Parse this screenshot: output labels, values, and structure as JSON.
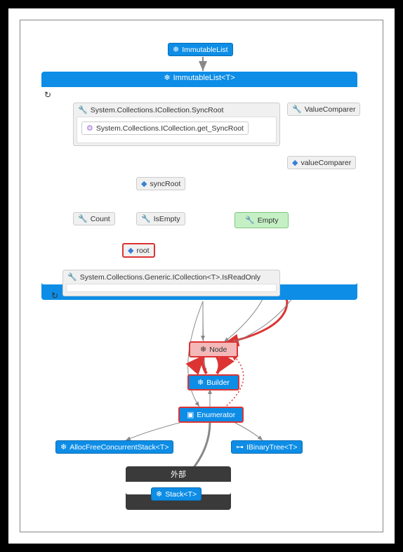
{
  "title_top": "ImmutableList",
  "container_main": "ImmutableList<T>",
  "syncroot_group": "System.Collections.ICollection.SyncRoot",
  "syncroot_method": "System.Collections.ICollection.get_SyncRoot",
  "syncroot_field": "syncRoot",
  "valuecomparer_prop": "ValueComparer",
  "valuecomparer_field": "valueComparer",
  "count": "Count",
  "isempty": "IsEmpty",
  "empty": "Empty",
  "root": "root",
  "readonly_group": "System.Collections.Generic.ICollection<T>.IsReadOnly",
  "node": "Node",
  "builder": "Builder",
  "enumerator": "Enumerator",
  "allocfree": "AllocFreeConcurrentStack<T>",
  "ibinarytree": "IBinaryTree<T>",
  "external_label": "外部",
  "stack": "Stack<T>",
  "icons": {
    "class": "❄",
    "wrench": "🔧",
    "field": "◆",
    "method": "⚙",
    "struct": "▣",
    "interface": "⊶",
    "cycle": "↻"
  },
  "chart_data": {
    "type": "diagram",
    "description": "Code map / dependency diagram for ImmutableList<T>",
    "nodes": [
      {
        "id": "ImmutableList",
        "kind": "class",
        "color": "blue"
      },
      {
        "id": "ImmutableList<T>",
        "kind": "class-container",
        "color": "blue",
        "children": [
          {
            "id": "System.Collections.ICollection.SyncRoot",
            "kind": "property-group",
            "children": [
              {
                "id": "System.Collections.ICollection.get_SyncRoot",
                "kind": "method"
              }
            ]
          },
          {
            "id": "syncRoot",
            "kind": "field"
          },
          {
            "id": "ValueComparer",
            "kind": "property"
          },
          {
            "id": "valueComparer",
            "kind": "field"
          },
          {
            "id": "Count",
            "kind": "property"
          },
          {
            "id": "IsEmpty",
            "kind": "property"
          },
          {
            "id": "Empty",
            "kind": "property",
            "highlight": "green"
          },
          {
            "id": "root",
            "kind": "field",
            "highlight": "red-border"
          },
          {
            "id": "System.Collections.Generic.ICollection<T>.IsReadOnly",
            "kind": "property-group"
          }
        ]
      },
      {
        "id": "Node",
        "kind": "class",
        "highlight": "pink"
      },
      {
        "id": "Builder",
        "kind": "class",
        "highlight": "red-border",
        "color": "blue"
      },
      {
        "id": "Enumerator",
        "kind": "struct",
        "highlight": "red-border",
        "color": "blue"
      },
      {
        "id": "AllocFreeConcurrentStack<T>",
        "kind": "class",
        "color": "blue"
      },
      {
        "id": "IBinaryTree<T>",
        "kind": "interface",
        "color": "blue"
      },
      {
        "id": "外部",
        "kind": "external-group",
        "children": [
          {
            "id": "Stack<T>",
            "kind": "class",
            "color": "blue"
          }
        ]
      }
    ],
    "edges": [
      {
        "from": "ImmutableList",
        "to": "ImmutableList<T>",
        "style": "solid"
      },
      {
        "from": "System.Collections.ICollection.get_SyncRoot",
        "to": "syncRoot",
        "style": "dashed"
      },
      {
        "from": "ValueComparer",
        "to": "valueComparer",
        "style": "dashed"
      },
      {
        "from": "ImmutableList<T>",
        "to": "Empty",
        "style": "solid-thick"
      },
      {
        "from": "Count",
        "to": "root",
        "style": "solid"
      },
      {
        "from": "IsEmpty",
        "to": "root",
        "style": "solid"
      },
      {
        "from": "root",
        "to": "Node",
        "style": "red-thick"
      },
      {
        "from": "Empty",
        "to": "Node",
        "style": "solid"
      },
      {
        "from": "Builder",
        "to": "Node",
        "style": "red-thick",
        "bidirectional": true
      },
      {
        "from": "Enumerator",
        "to": "Node",
        "style": "red-dotted"
      },
      {
        "from": "Enumerator",
        "to": "Builder",
        "style": "solid"
      },
      {
        "from": "Enumerator",
        "to": "AllocFreeConcurrentStack<T>",
        "style": "solid"
      },
      {
        "from": "Enumerator",
        "to": "IBinaryTree<T>",
        "style": "solid"
      },
      {
        "from": "Enumerator",
        "to": "Stack<T>",
        "style": "solid-thick"
      },
      {
        "from": "ImmutableList<T>",
        "to": "Node",
        "style": "solid"
      },
      {
        "from": "ImmutableList<T>",
        "to": "Builder",
        "style": "solid"
      },
      {
        "from": "ImmutableList<T>",
        "to": "Enumerator",
        "style": "solid"
      },
      {
        "from": "valueComparer",
        "to": "Node",
        "style": "solid"
      },
      {
        "from": "System.Collections.Generic.ICollection<T>.IsReadOnly",
        "to": "ImmutableList<T>",
        "style": "cycle"
      }
    ]
  }
}
